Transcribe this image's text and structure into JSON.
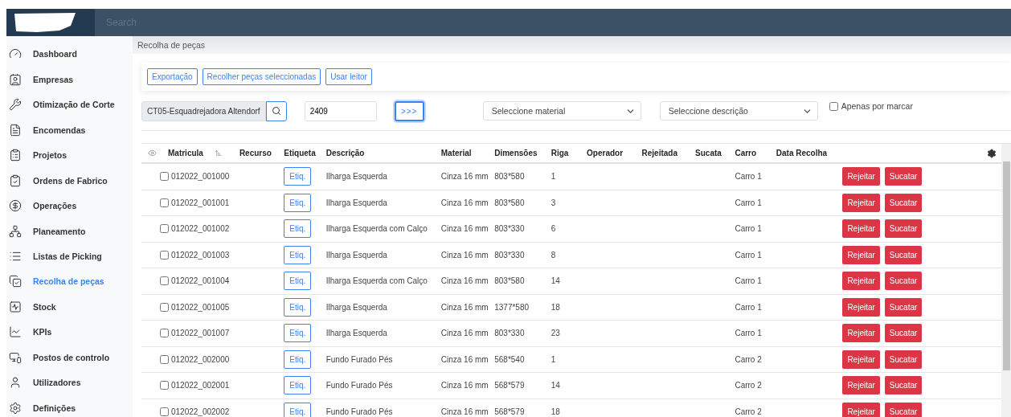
{
  "topbar": {
    "search_placeholder": "Search"
  },
  "sidebar": {
    "items": [
      {
        "label": "Dashboard",
        "selected": false
      },
      {
        "label": "Empresas",
        "selected": false
      },
      {
        "label": "Otimização de Corte",
        "selected": false
      },
      {
        "label": "Encomendas",
        "selected": false
      },
      {
        "label": "Projetos",
        "selected": false
      },
      {
        "label": "Ordens de Fabrico",
        "selected": false
      },
      {
        "label": "Operações",
        "selected": false
      },
      {
        "label": "Planeamento",
        "selected": false
      },
      {
        "label": "Listas de Picking",
        "selected": false
      },
      {
        "label": "Recolha de peças",
        "selected": true
      },
      {
        "label": "Stock",
        "selected": false
      },
      {
        "label": "KPIs",
        "selected": false
      },
      {
        "label": "Postos de controlo",
        "selected": false
      },
      {
        "label": "Utilizadores",
        "selected": false
      },
      {
        "label": "Definições",
        "selected": false
      }
    ]
  },
  "breadcrumb": "Recolha de peças",
  "toolbar": {
    "buttons": [
      "Exportação",
      "Recolher peças seleccionadas",
      "Usar leitor"
    ]
  },
  "filters": {
    "resource": "CT05-Esquadrejadora Altendorf",
    "number": "2409",
    "go_button": ">>>",
    "material_placeholder": "Seleccione material",
    "description_placeholder": "Seleccione descrição",
    "only_unmarked": {
      "label": "Apenas por marcar",
      "checked": false
    }
  },
  "table": {
    "columns": [
      "Matricula",
      "Recurso",
      "Etiqueta",
      "Descrição",
      "Material",
      "Dimensões",
      "Riga",
      "Operador",
      "Rejeitada",
      "Sucata",
      "Carro",
      "Data Recolha"
    ],
    "rows": [
      {
        "matricula": "012022_001000",
        "checked": false,
        "etiqueta": "Etiq.",
        "descricao": "Ilharga Esquerda",
        "material": "Cinza 16 mm",
        "dimensoes": "803*580",
        "riga": "1",
        "carro": "Carro 1",
        "actions": [
          "Rejeitar",
          "Sucatar"
        ]
      },
      {
        "matricula": "012022_001001",
        "checked": false,
        "etiqueta": "Etiq.",
        "descricao": "Ilharga Esquerda",
        "material": "Cinza 16 mm",
        "dimensoes": "803*580",
        "riga": "3",
        "carro": "Carro 1",
        "actions": [
          "Rejeitar",
          "Sucatar"
        ]
      },
      {
        "matricula": "012022_001002",
        "checked": false,
        "etiqueta": "Etiq.",
        "descricao": "Ilharga Esquerda com Calço",
        "material": "Cinza 16 mm",
        "dimensoes": "803*330",
        "riga": "6",
        "carro": "Carro 1",
        "actions": [
          "Rejeitar",
          "Sucatar"
        ]
      },
      {
        "matricula": "012022_001003",
        "checked": false,
        "etiqueta": "Etiq.",
        "descricao": "Ilharga Esquerda",
        "material": "Cinza 16 mm",
        "dimensoes": "803*330",
        "riga": "8",
        "carro": "Carro 1",
        "actions": [
          "Rejeitar",
          "Sucatar"
        ]
      },
      {
        "matricula": "012022_001004",
        "checked": false,
        "etiqueta": "Etiq.",
        "descricao": "Ilharga Esquerda com Calço",
        "material": "Cinza 16 mm",
        "dimensoes": "803*580",
        "riga": "14",
        "carro": "Carro 1",
        "actions": [
          "Rejeitar",
          "Sucatar"
        ]
      },
      {
        "matricula": "012022_001005",
        "checked": false,
        "etiqueta": "Etiq.",
        "descricao": "Ilharga Esquerda",
        "material": "Cinza 16 mm",
        "dimensoes": "1377*580",
        "riga": "18",
        "carro": "Carro 1",
        "actions": [
          "Rejeitar",
          "Sucatar"
        ]
      },
      {
        "matricula": "012022_001007",
        "checked": false,
        "etiqueta": "Etiq.",
        "descricao": "Ilharga Esquerda",
        "material": "Cinza 16 mm",
        "dimensoes": "803*330",
        "riga": "23",
        "carro": "Carro 1",
        "actions": [
          "Rejeitar",
          "Sucatar"
        ]
      },
      {
        "matricula": "012022_002000",
        "checked": false,
        "etiqueta": "Etiq.",
        "descricao": "Fundo Furado Pés",
        "material": "Cinza 16 mm",
        "dimensoes": "568*540",
        "riga": "1",
        "carro": "Carro 2",
        "actions": [
          "Rejeitar",
          "Sucatar"
        ]
      },
      {
        "matricula": "012022_002001",
        "checked": false,
        "etiqueta": "Etiq.",
        "descricao": "Fundo Furado Pés",
        "material": "Cinza 16 mm",
        "dimensoes": "568*579",
        "riga": "14",
        "carro": "Carro 2",
        "actions": [
          "Rejeitar",
          "Sucatar"
        ]
      },
      {
        "matricula": "012022_002002",
        "checked": false,
        "etiqueta": "Etiq.",
        "descricao": "Fundo Furado Pés",
        "material": "Cinza 16 mm",
        "dimensoes": "568*579",
        "riga": "18",
        "carro": "Carro 2",
        "actions": [
          "Rejeitar",
          "Sucatar"
        ]
      }
    ]
  }
}
